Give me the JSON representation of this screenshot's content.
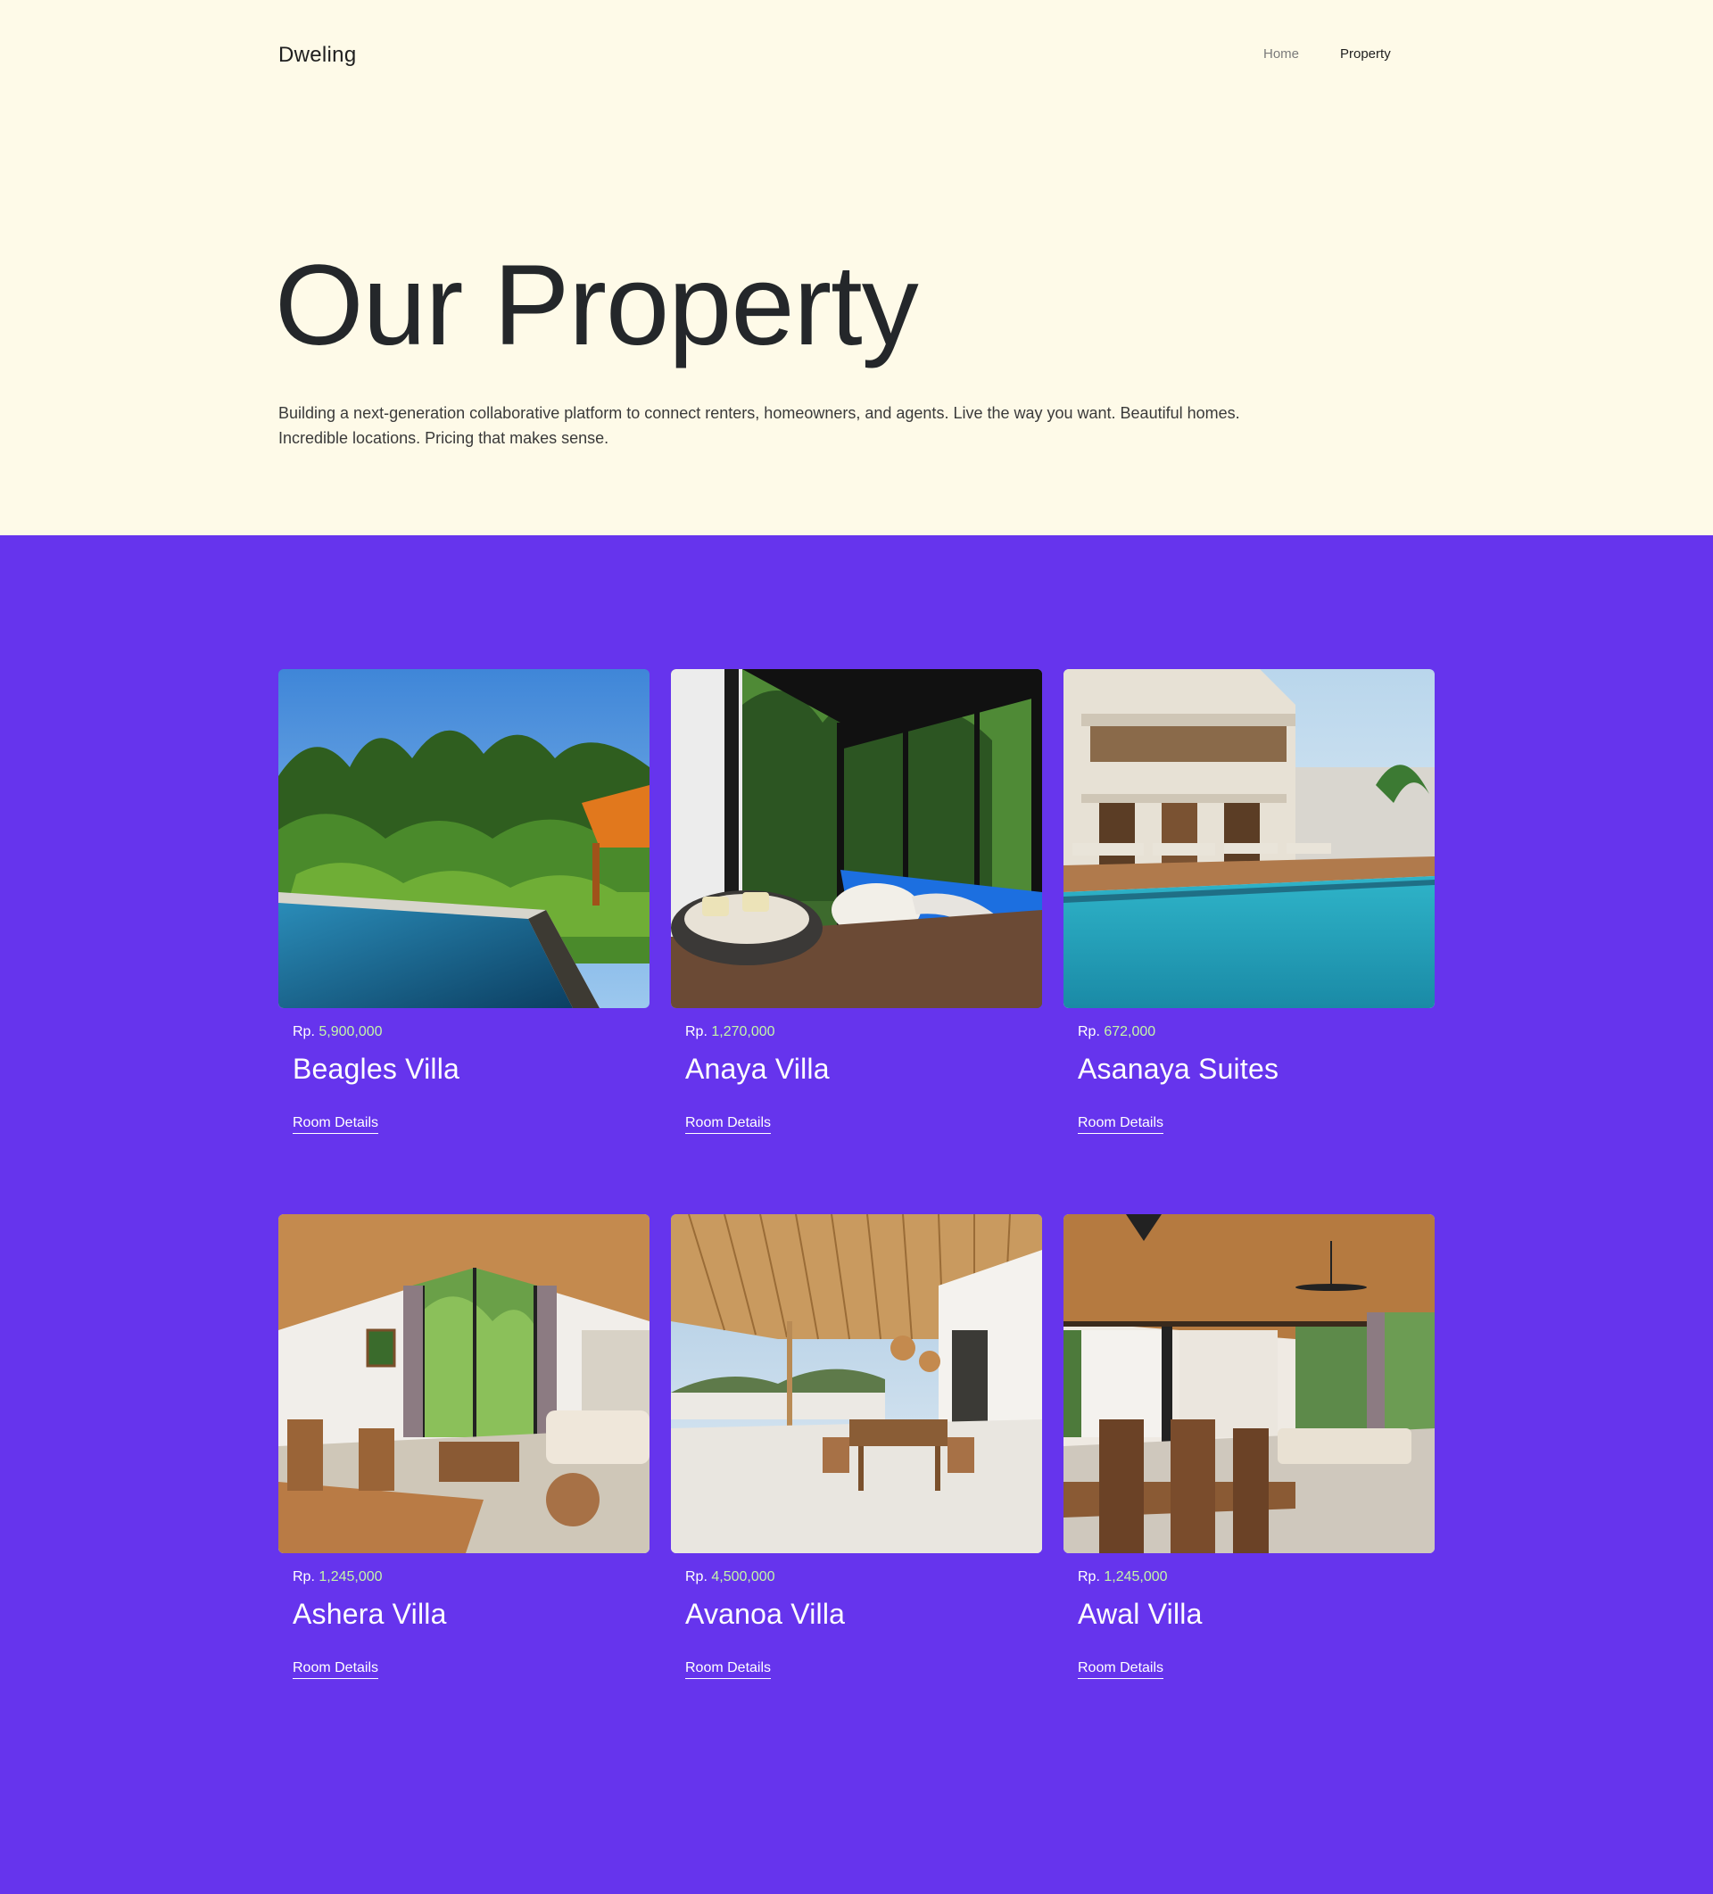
{
  "header": {
    "brand": "Dweling",
    "nav": [
      {
        "label": "Home"
      },
      {
        "label": "Property"
      }
    ]
  },
  "hero": {
    "title": "Our Property",
    "description": "Building a next-generation collaborative platform to connect renters, homeowners, and agents. Live the way you want. Beautiful homes. Incredible locations. Pricing that makes sense."
  },
  "properties": [
    {
      "currency": "Rp.",
      "price": "5,900,000",
      "name": "Beagles Villa",
      "link": "Room Details"
    },
    {
      "currency": "Rp.",
      "price": "1,270,000",
      "name": "Anaya Villa",
      "link": "Room Details"
    },
    {
      "currency": "Rp.",
      "price": "672,000",
      "name": "Asanaya Suites",
      "link": "Room Details"
    },
    {
      "currency": "Rp.",
      "price": "1,245,000",
      "name": "Ashera Villa",
      "link": "Room Details"
    },
    {
      "currency": "Rp.",
      "price": "4,500,000",
      "name": "Avanoa Villa",
      "link": "Room Details"
    },
    {
      "currency": "Rp.",
      "price": "1,245,000",
      "name": "Awal Villa",
      "link": "Room Details"
    }
  ],
  "colors": {
    "hero_bg": "#fefae8",
    "section_bg": "#6634ed",
    "price_accent": "#c3f5a8",
    "text_dark": "#24272a"
  }
}
